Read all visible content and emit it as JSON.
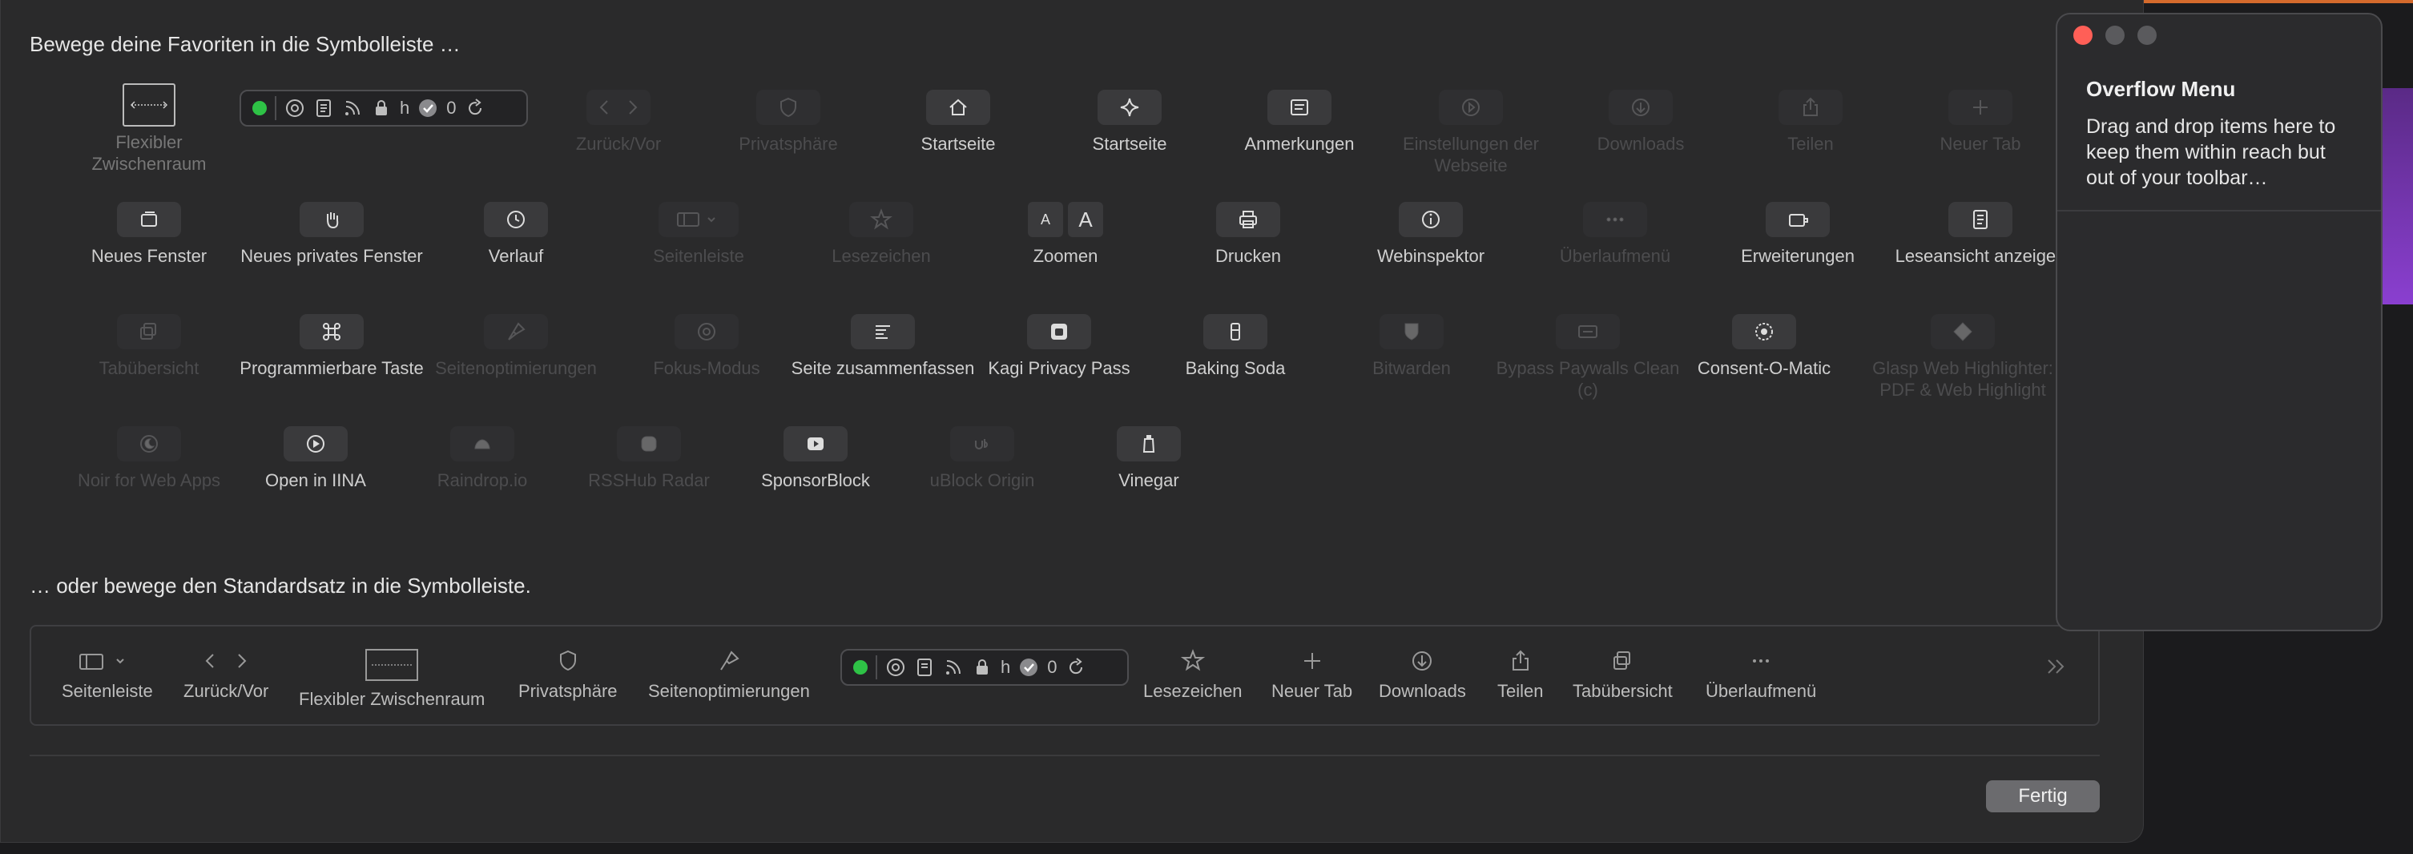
{
  "headings": {
    "favorites": "Bewege deine Favoriten in die Symbolleiste …",
    "defaults": "… oder bewege den Standardsatz in die Symbolleiste."
  },
  "palette": {
    "flex_space": "Flexibler Zwischenraum",
    "address_count": "0",
    "address_letter": "h",
    "row1": {
      "back_forward": "Zurück/Vor",
      "privacy": "Privatsphäre",
      "home": "Startseite",
      "start_page": "Startseite",
      "notes": "Anmerkungen",
      "site_settings": "Einstellungen der Webseite",
      "downloads": "Downloads",
      "share": "Teilen",
      "new_tab": "Neuer Tab"
    },
    "row2": {
      "new_window": "Neues Fenster",
      "new_private_window": "Neues privates Fenster",
      "history": "Verlauf",
      "sidebar": "Seitenleiste",
      "bookmarks": "Lesezeichen",
      "zoom": "Zoomen",
      "print": "Drucken",
      "web_inspector": "Webinspektor",
      "overflow_menu": "Überlaufmenü",
      "extensions": "Erweiterungen",
      "reader": "Leseansicht anzeigen"
    },
    "zoom_glyph_small": "A",
    "zoom_glyph_large": "A",
    "row3": {
      "tab_overview": "Tabübersicht",
      "programmable_key": "Programmierbare Taste",
      "page_optimizations": "Seitenoptimierungen",
      "focus_mode": "Fokus-Modus",
      "summarize": "Seite zusammenfassen",
      "kagi": "Kagi Privacy Pass",
      "baking_soda": "Baking Soda",
      "bitwarden": "Bitwarden",
      "bypass_paywalls": "Bypass Paywalls Clean (c)",
      "consent": "Consent-O-Matic",
      "glasp": "Glasp Web Highlighter: PDF & Web Highlight"
    },
    "row4": {
      "noir": "Noir for Web Apps",
      "iina": "Open in IINA",
      "raindrop": "Raindrop.io",
      "rsshub": "RSSHub Radar",
      "sponsorblock": "SponsorBlock",
      "ublock": "uBlock Origin",
      "vinegar": "Vinegar"
    }
  },
  "default_set": {
    "sidebar": "Seitenleiste",
    "back_forward": "Zurück/Vor",
    "flex_space": "Flexibler Zwischenraum",
    "privacy": "Privatsphäre",
    "page_optimizations": "Seitenoptimierungen",
    "bookmarks": "Lesezeichen",
    "new_tab": "Neuer Tab",
    "downloads": "Downloads",
    "share": "Teilen",
    "tab_overview": "Tabübersicht",
    "overflow_menu": "Überlaufmenü"
  },
  "done_button": "Fertig",
  "overflow_window": {
    "title": "Overflow Menu",
    "text": "Drag and drop items here to keep them within reach but out of your toolbar…"
  },
  "bottom_hint": "… … … … … … … …",
  "colors": {
    "accent": "#d46a2c",
    "close": "#ff5f57",
    "status_green": "#2ec246"
  }
}
